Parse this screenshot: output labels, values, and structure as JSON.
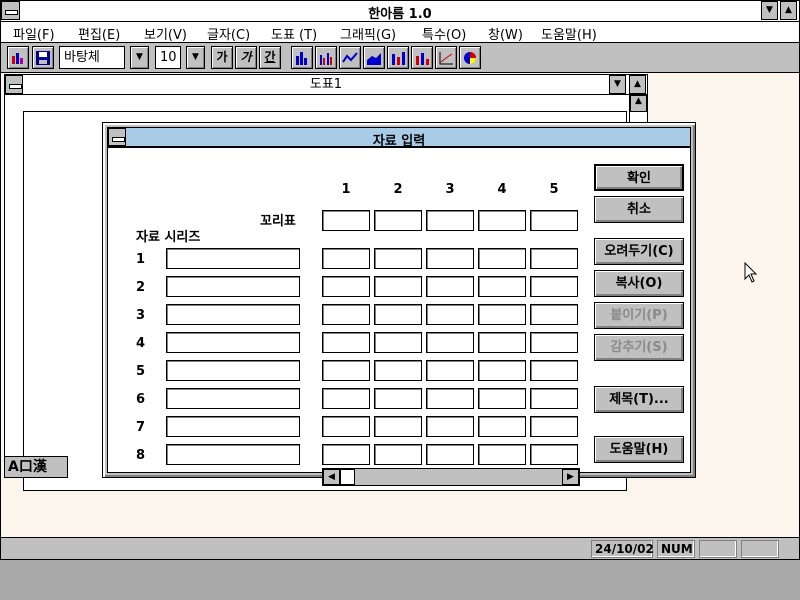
{
  "app": {
    "title": "한아름 1.0"
  },
  "menu": [
    {
      "label": "파일(F)"
    },
    {
      "label": "편집(E)"
    },
    {
      "label": "보기(V)"
    },
    {
      "label": "글자(C)"
    },
    {
      "label": "도표 (T)"
    },
    {
      "label": "그래픽(G)"
    },
    {
      "label": "특수(O)"
    },
    {
      "label": "창(W)"
    },
    {
      "label": "도움말(H)"
    }
  ],
  "toolbar": {
    "font": "바탕체",
    "size": "10",
    "bold": "가",
    "italic": "가",
    "underline": "간"
  },
  "document": {
    "title": "도표1"
  },
  "ime": {
    "label": "A口漢"
  },
  "dialog": {
    "title": "자료 입력",
    "columns": [
      "1",
      "2",
      "3",
      "4",
      "5"
    ],
    "header_label": "꼬리표",
    "series_label": "자료 시리즈",
    "rows": [
      "1",
      "2",
      "3",
      "4",
      "5",
      "6",
      "7",
      "8"
    ],
    "buttons": {
      "ok": "확인",
      "cancel": "취소",
      "cut": "오려두기(C)",
      "copy": "복사(O)",
      "paste": "붙이기(P)",
      "hide": "감추기(S)",
      "titles": "제목(T)...",
      "help": "도움말(H)"
    }
  },
  "status": {
    "date": "24/10/02",
    "num": "NUM"
  }
}
